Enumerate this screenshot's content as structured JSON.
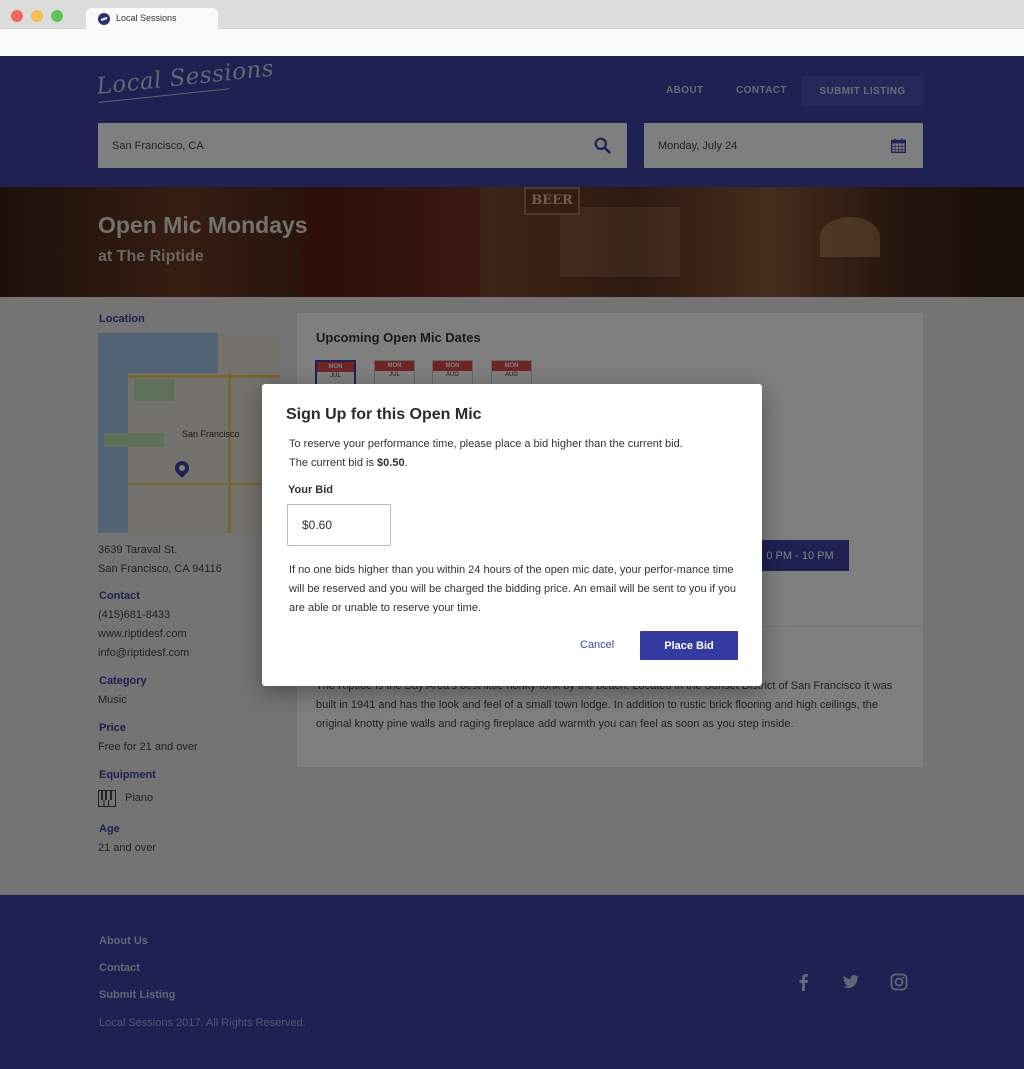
{
  "browser": {
    "tab_title": "Local Sessions",
    "icons": {
      "favicon": "local-sessions-logo-icon"
    }
  },
  "header": {
    "logo_text": "Local Sessions",
    "nav": {
      "about": "ABOUT",
      "contact": "CONTACT",
      "submit": "SUBMIT LISTING"
    },
    "location_value": "San Francisco, CA",
    "date_value": "Monday, July 24",
    "icons": {
      "search": "search-icon",
      "calendar": "calendar-icon"
    }
  },
  "hero": {
    "title": "Open Mic Mondays",
    "subtitle": "at The Riptide",
    "sign_text": "BEER"
  },
  "sidebar": {
    "location_label": "Location",
    "map_label": "San Francisco",
    "address_line1": "3639 Taraval St.",
    "address_line2": "San Francisco, CA 94116",
    "contact_label": "Contact",
    "phone": "(415)681-8433",
    "website": "www.riptidesf.com",
    "email": "info@riptidesf.com",
    "category_label": "Category",
    "category_value": "Music",
    "price_label": "Price",
    "price_value": "Free for 21 and over",
    "equipment_label": "Equipment",
    "equipment_value": "Piano",
    "age_label": "Age",
    "age_value": "21 and over"
  },
  "main": {
    "dates_title": "Upcoming Open Mic Dates",
    "dates": [
      {
        "day": "MON",
        "month": "JUL"
      },
      {
        "day": "MON",
        "month": "JUL"
      },
      {
        "day": "MON",
        "month": "AUG"
      },
      {
        "day": "MON",
        "month": "AUG"
      }
    ],
    "time_slot": "0 PM - 10 PM",
    "description": "The Riptide is the Bay Area's best little honky-tonk by the beach. Located in the Sunset District of San Francisco it was built in 1941 and has the look and feel of a small town lodge. In addition to rustic brick flooring and high ceilings, the original knotty pine walls and raging fireplace add warmth you can feel as soon as you step inside."
  },
  "modal": {
    "title": "Sign Up for this Open Mic",
    "intro": "To reserve your performance time, please place a bid higher than the current bid.",
    "current_bid_prefix": "The current bid is ",
    "current_bid": "$0.50",
    "current_bid_suffix": ".",
    "bid_label": "Your Bid",
    "bid_value": "$0.60",
    "note": "If no one bids higher than you within 24 hours of the open mic date, your perfor-mance time will be reserved and you will be charged the bidding price. An email will be sent to you if you are able or unable to reserve your time.",
    "cancel_label": "Cancel",
    "submit_label": "Place Bid"
  },
  "footer": {
    "links": [
      "About Us",
      "Contact",
      "Submit Listing"
    ],
    "copyright": "Local Sessions 2017. All Rights Reserved.",
    "icons": [
      "facebook-icon",
      "twitter-icon",
      "instagram-icon"
    ]
  },
  "colors": {
    "brand": "#3d43a3",
    "button": "#343aa0",
    "calendar_red": "#e04a4a"
  }
}
